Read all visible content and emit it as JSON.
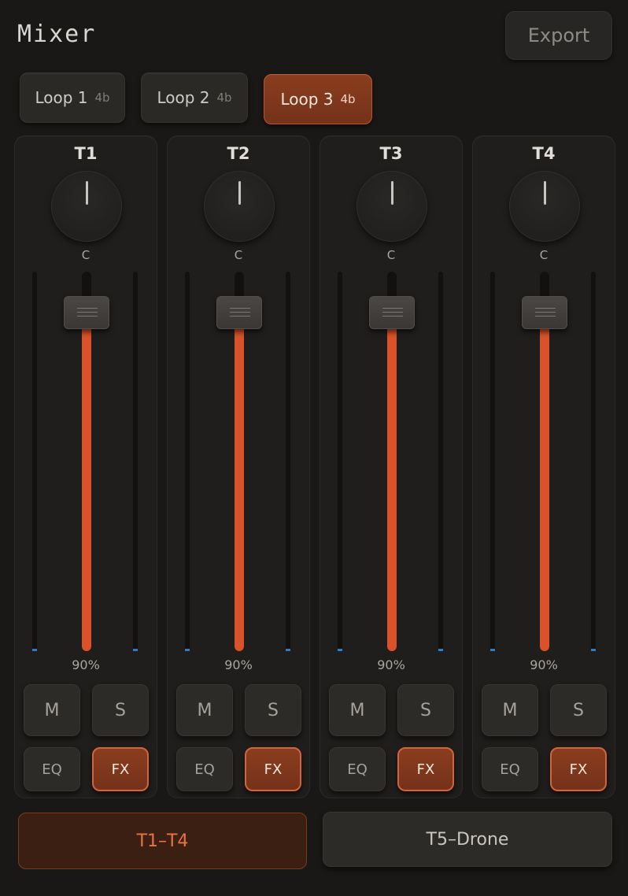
{
  "header": {
    "title": "Mixer",
    "export_label": "Export"
  },
  "loops": [
    {
      "label": "Loop 1",
      "beats": "4b",
      "active": false
    },
    {
      "label": "Loop 2",
      "beats": "4b",
      "active": false
    },
    {
      "label": "Loop 3",
      "beats": "4b",
      "active": true
    }
  ],
  "channels": [
    {
      "name": "T1",
      "pan": "C",
      "volume_label": "90%",
      "volume": 0.9,
      "mute": "M",
      "solo": "S",
      "eq": "EQ",
      "fx": "FX",
      "fx_active": true
    },
    {
      "name": "T2",
      "pan": "C",
      "volume_label": "90%",
      "volume": 0.9,
      "mute": "M",
      "solo": "S",
      "eq": "EQ",
      "fx": "FX",
      "fx_active": true
    },
    {
      "name": "T3",
      "pan": "C",
      "volume_label": "90%",
      "volume": 0.9,
      "mute": "M",
      "solo": "S",
      "eq": "EQ",
      "fx": "FX",
      "fx_active": true
    },
    {
      "name": "T4",
      "pan": "C",
      "volume_label": "90%",
      "volume": 0.9,
      "mute": "M",
      "solo": "S",
      "eq": "EQ",
      "fx": "FX",
      "fx_active": true
    }
  ],
  "groups": [
    {
      "label": "T1–T4",
      "active": true
    },
    {
      "label": "T5–Drone",
      "active": false
    }
  ],
  "colors": {
    "accent": "#d9522a",
    "meter_blip": "#2f7cc0",
    "background": "#1a1816"
  }
}
